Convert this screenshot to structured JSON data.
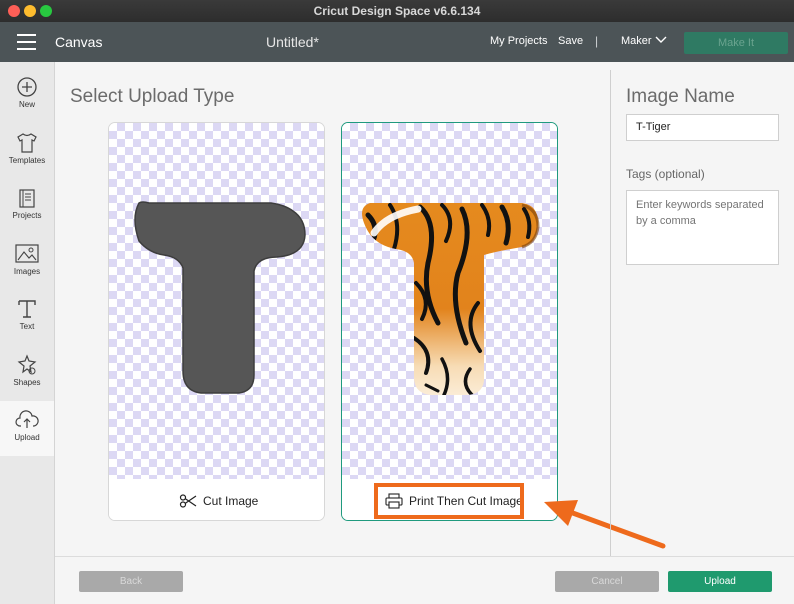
{
  "window": {
    "title": "Cricut Design Space  v6.6.134"
  },
  "header": {
    "section": "Canvas",
    "doc_title": "Untitled*",
    "my_projects": "My Projects",
    "save": "Save",
    "separator": "|",
    "machine": "Maker",
    "make_it": "Make It"
  },
  "sidebar": {
    "items": [
      {
        "label": "New",
        "icon": "plus-circle-icon"
      },
      {
        "label": "Templates",
        "icon": "tshirt-icon"
      },
      {
        "label": "Projects",
        "icon": "projects-icon"
      },
      {
        "label": "Images",
        "icon": "image-icon"
      },
      {
        "label": "Text",
        "icon": "text-icon"
      },
      {
        "label": "Shapes",
        "icon": "shapes-icon"
      },
      {
        "label": "Upload",
        "icon": "cloud-upload-icon"
      }
    ]
  },
  "main": {
    "title": "Select Upload Type",
    "options": [
      {
        "label": "Cut Image",
        "icon": "scissors-icon"
      },
      {
        "label": "Print Then Cut Image",
        "icon": "printer-icon"
      }
    ]
  },
  "right_panel": {
    "title": "Image Name",
    "name_value": "T-Tiger",
    "tags_label": "Tags (optional)",
    "tags_placeholder": "Enter keywords separated by a comma"
  },
  "footer": {
    "back": "Back",
    "cancel": "Cancel",
    "upload": "Upload"
  },
  "colors": {
    "accent": "#1f9a6e",
    "highlight": "#ee6a1c",
    "header_bg": "#4c5457"
  }
}
